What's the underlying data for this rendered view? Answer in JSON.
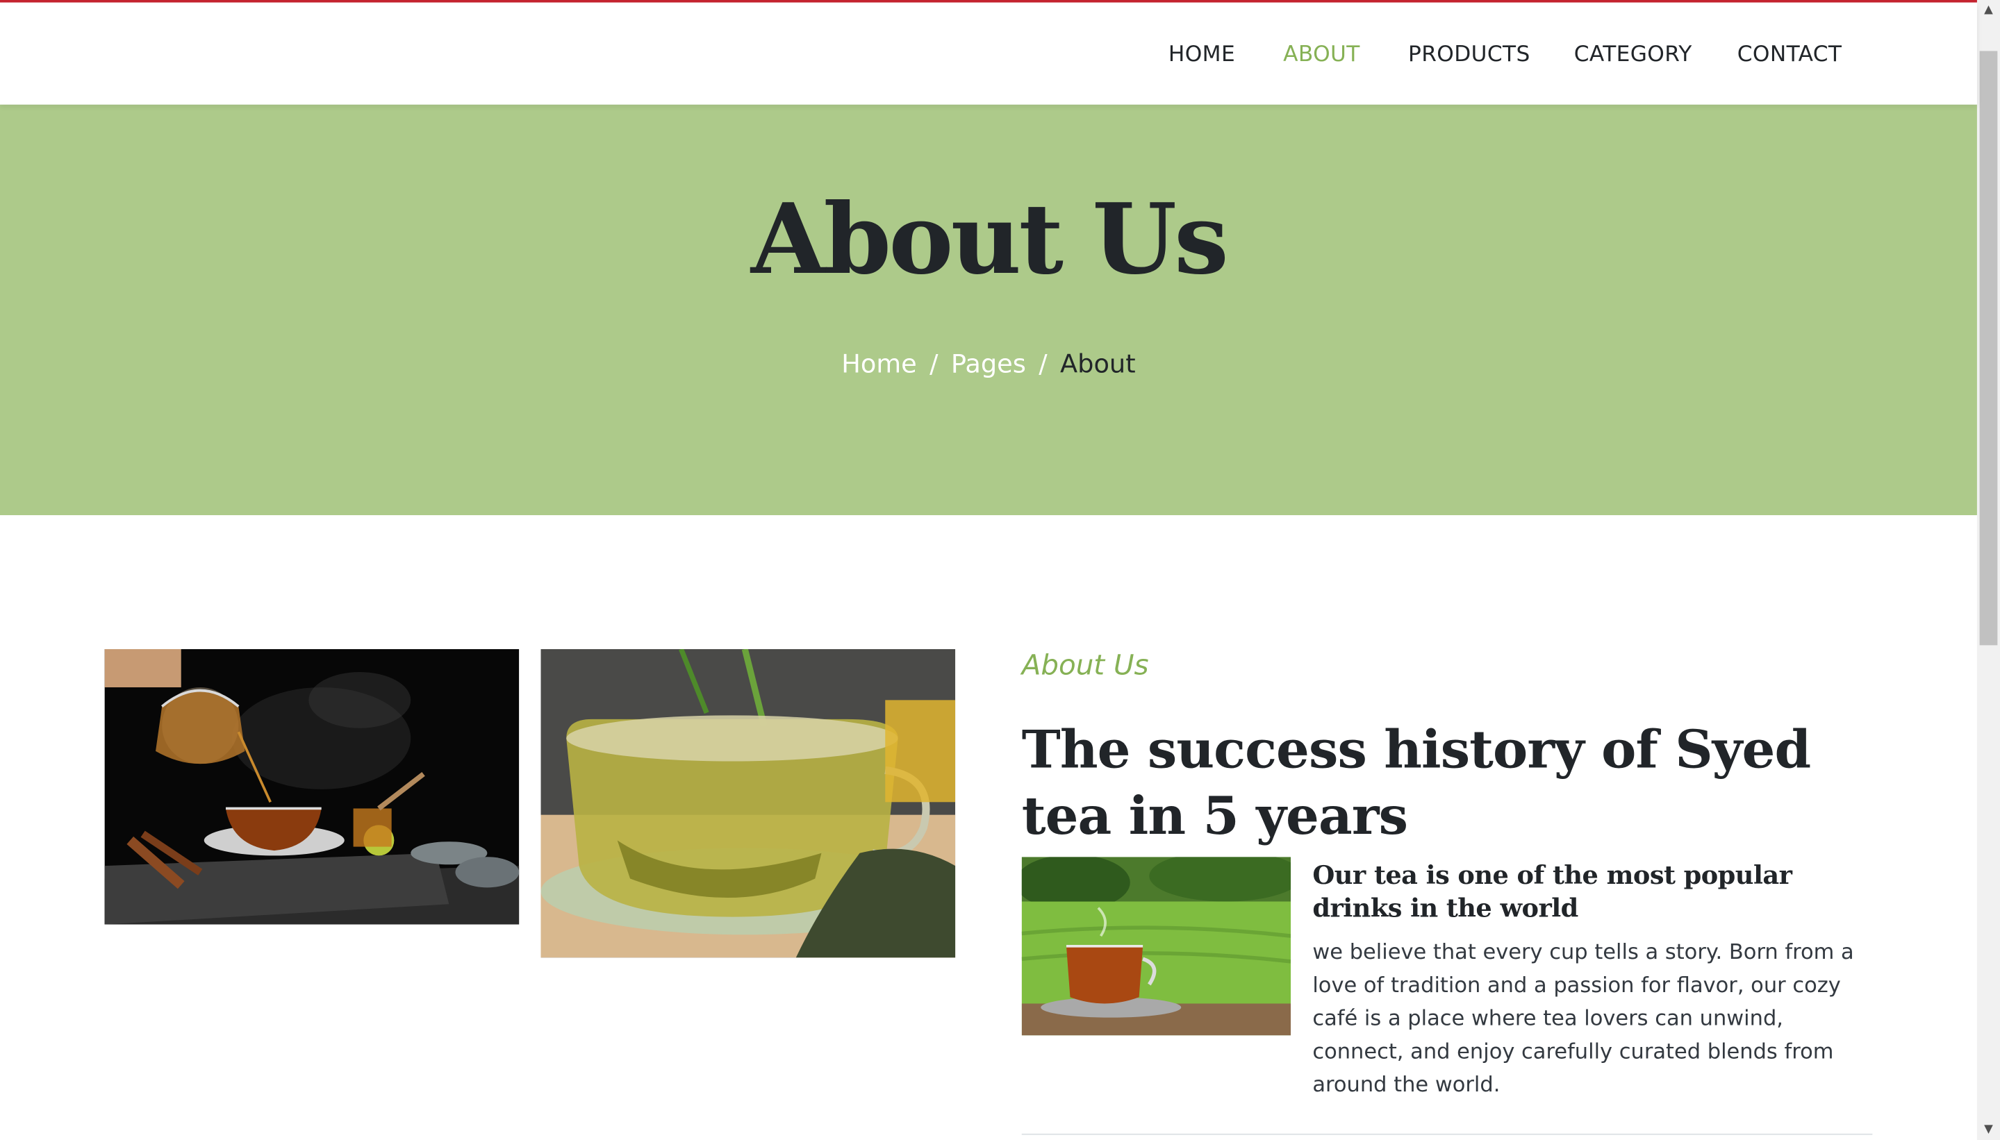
{
  "nav": {
    "items": [
      {
        "label": "HOME",
        "active": false
      },
      {
        "label": "ABOUT",
        "active": true
      },
      {
        "label": "PRODUCTS",
        "active": false
      },
      {
        "label": "CATEGORY",
        "active": false
      },
      {
        "label": "CONTACT",
        "active": false
      }
    ]
  },
  "hero": {
    "title": "About Us",
    "breadcrumb": {
      "home": "Home",
      "pages": "Pages",
      "current": "About",
      "separator": "/"
    }
  },
  "about": {
    "eyebrow": "About Us",
    "headline": "The success history of Syed tea in 5 years",
    "feature_title": "Our tea is one of the most popular drinks in the world",
    "feature_text": "we believe that every cup tells a story. Born from a love of tradition and a passion for flavor, our cozy café is a place where tea lovers can unwind, connect, and enjoy carefully curated blends from around the world."
  },
  "colors": {
    "accent_green": "#86b155",
    "hero_bg": "#adca8a",
    "top_border": "#c5232f",
    "text_dark": "#212529"
  },
  "icons": {
    "scroll_up": "triangle-up-icon",
    "scroll_down": "triangle-down-icon"
  }
}
